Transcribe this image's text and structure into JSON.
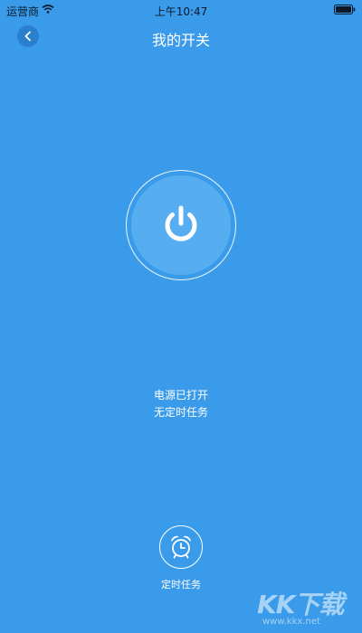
{
  "status_bar": {
    "carrier": "运营商",
    "time": "上午10:47"
  },
  "nav": {
    "title": "我的开关"
  },
  "device": {
    "power_status": "电源已打开",
    "timer_status": "无定时任务"
  },
  "timer": {
    "label": "定时任务"
  },
  "watermark": {
    "logo": "KK下载",
    "url": "www.kkx.net"
  },
  "colors": {
    "background": "#3a9bea",
    "button_fill": "#56aef0",
    "text": "#ffffff"
  },
  "icons": {
    "back": "chevron-left-icon",
    "power": "power-icon",
    "timer": "alarm-clock-icon",
    "wifi": "wifi-icon",
    "battery": "battery-icon"
  }
}
